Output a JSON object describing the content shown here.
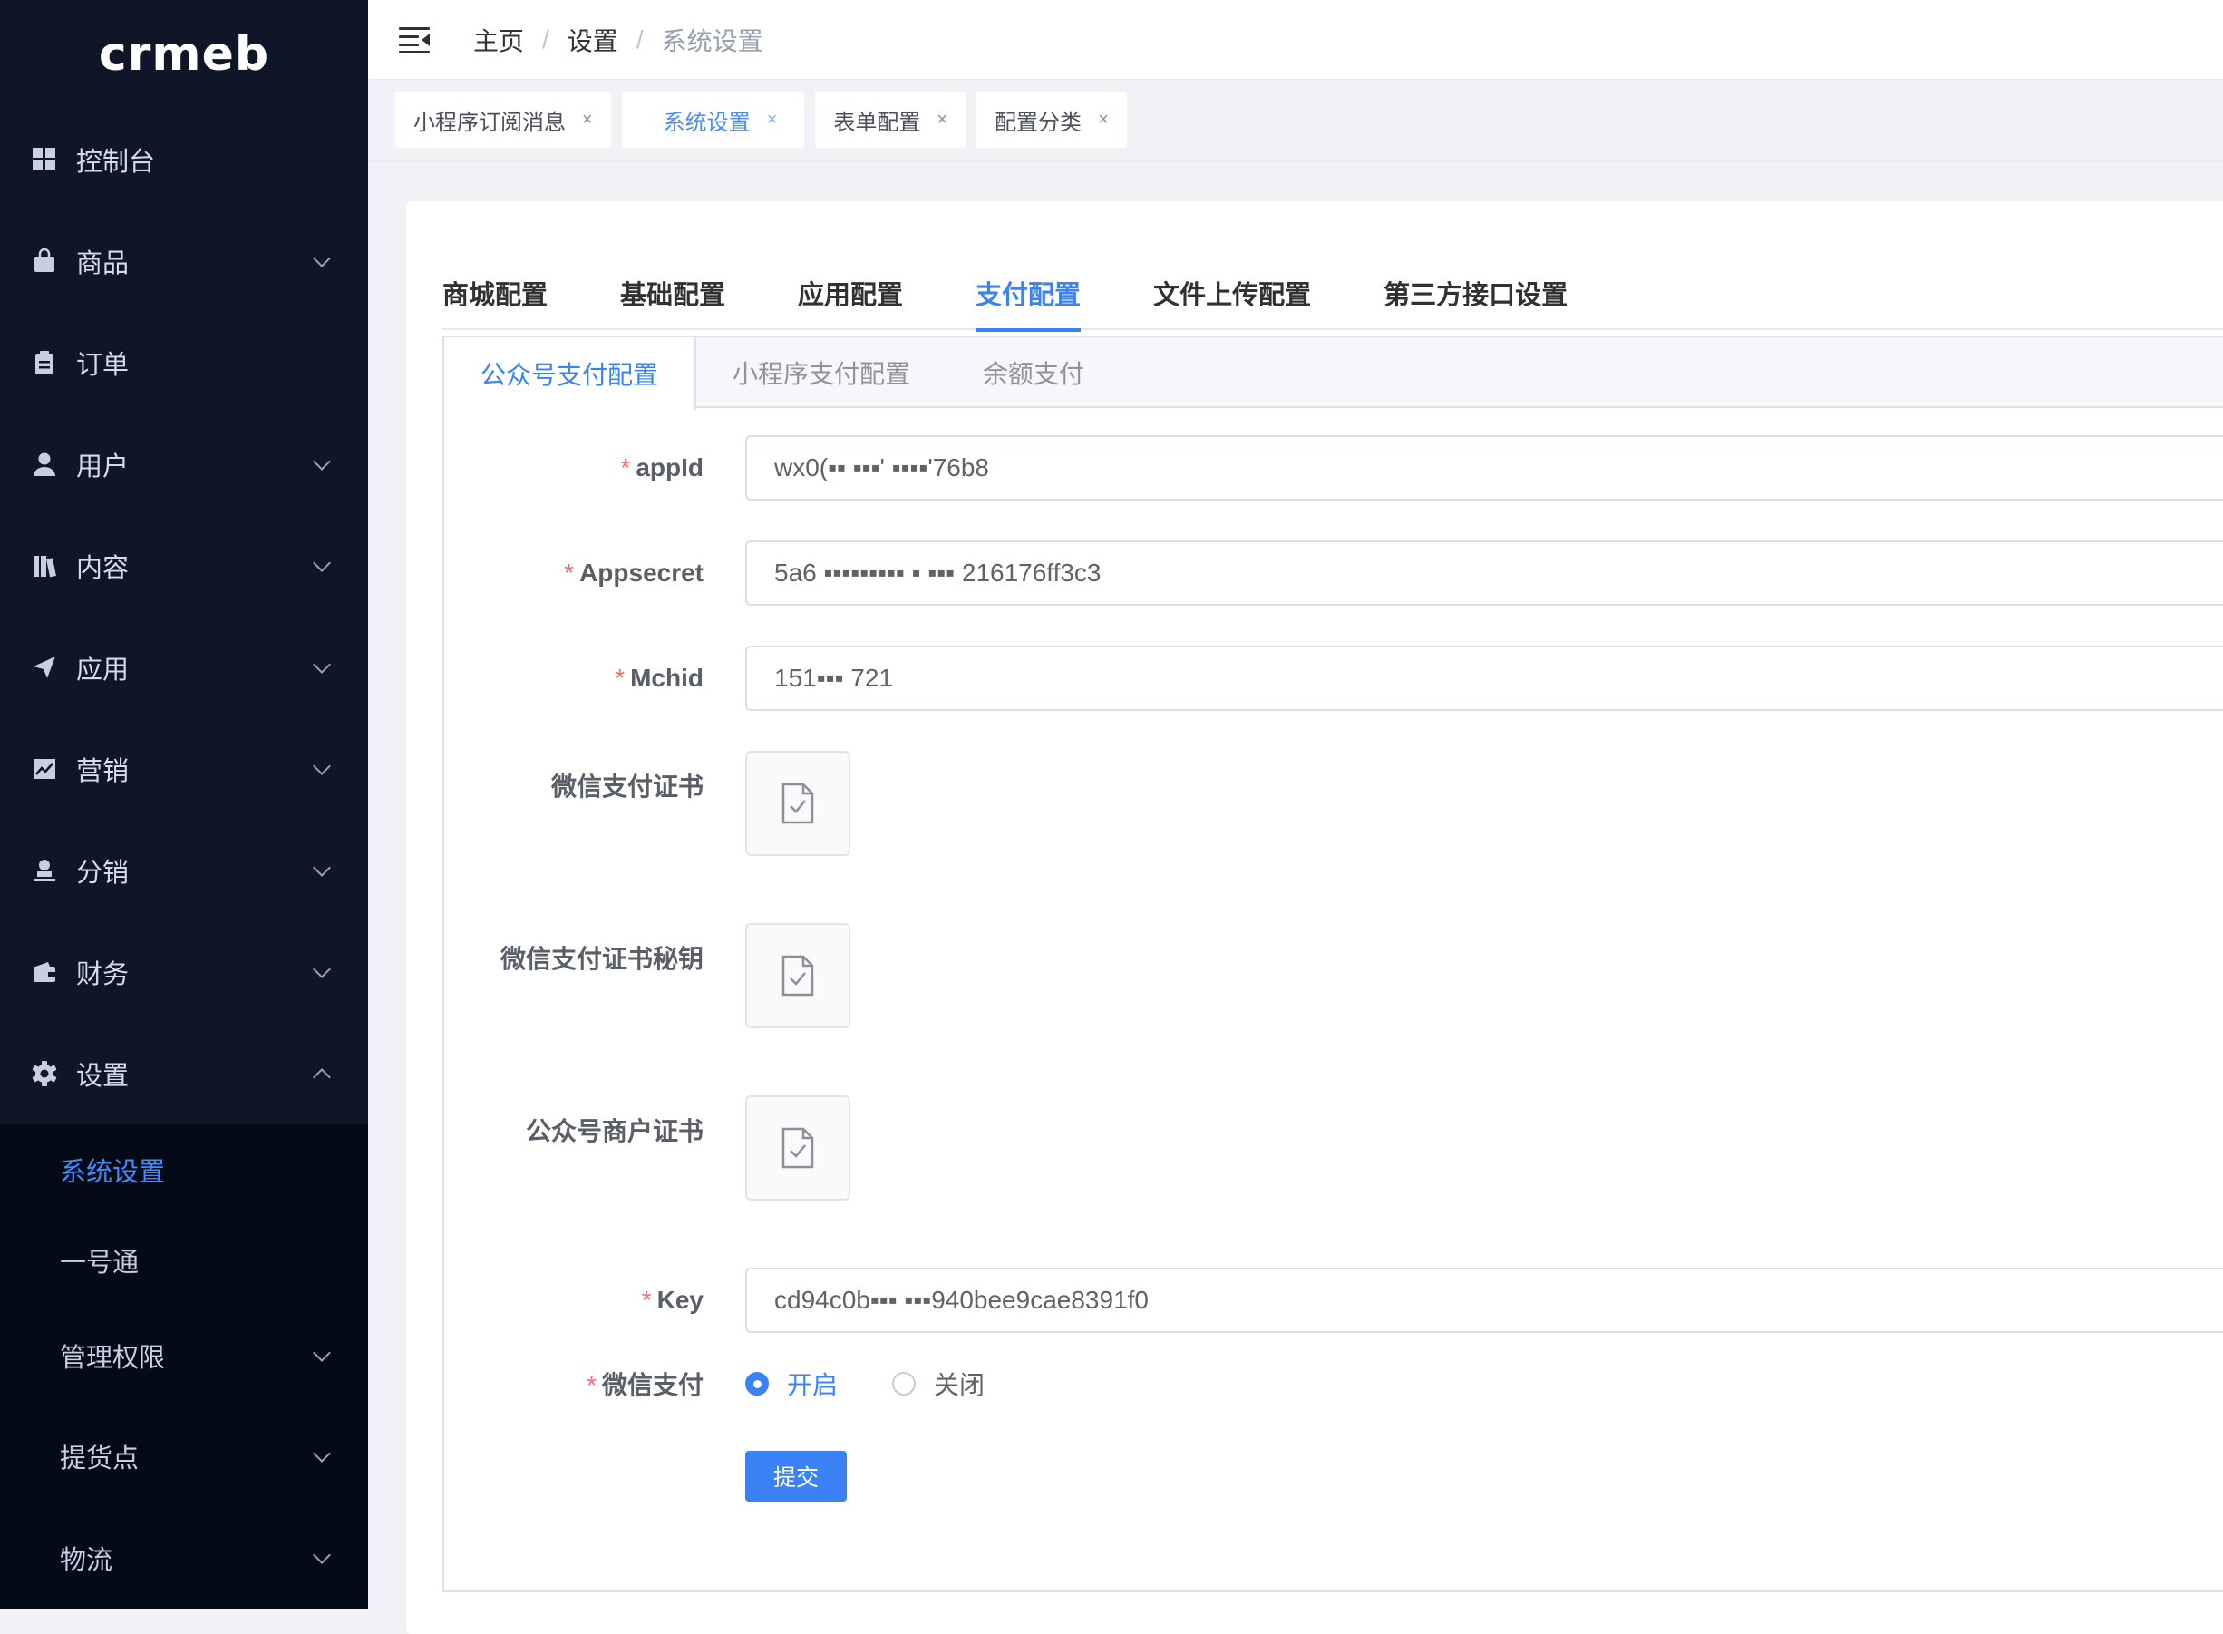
{
  "sidebar": {
    "logo": "crmeb",
    "items": [
      {
        "label": "控制台",
        "icon": "dashboard-icon",
        "has_arrow": false
      },
      {
        "label": "商品",
        "icon": "bag-icon",
        "has_arrow": true
      },
      {
        "label": "订单",
        "icon": "clipboard-icon",
        "has_arrow": false
      },
      {
        "label": "用户",
        "icon": "user-icon",
        "has_arrow": true
      },
      {
        "label": "内容",
        "icon": "library-icon",
        "has_arrow": true
      },
      {
        "label": "应用",
        "icon": "send-icon",
        "has_arrow": true
      },
      {
        "label": "营销",
        "icon": "chart-icon",
        "has_arrow": true
      },
      {
        "label": "分销",
        "icon": "stamp-icon",
        "has_arrow": true
      },
      {
        "label": "财务",
        "icon": "wallet-icon",
        "has_arrow": true
      },
      {
        "label": "设置",
        "icon": "gear-icon",
        "has_arrow": true,
        "expanded": true
      }
    ],
    "submenu": [
      {
        "label": "系统设置",
        "active": true
      },
      {
        "label": "一号通",
        "has_arrow": false
      },
      {
        "label": "管理权限",
        "has_arrow": true
      },
      {
        "label": "提货点",
        "has_arrow": true
      },
      {
        "label": "物流",
        "has_arrow": true
      }
    ]
  },
  "header": {
    "breadcrumb": [
      "主页",
      "设置",
      "系统设置"
    ],
    "separator": "/"
  },
  "tags": [
    {
      "label": "小程序订阅消息",
      "active": false
    },
    {
      "label": "系统设置",
      "active": true
    },
    {
      "label": "表单配置",
      "active": false
    },
    {
      "label": "配置分类",
      "active": false
    }
  ],
  "tag_close": "×",
  "main_tabs": [
    "商城配置",
    "基础配置",
    "应用配置",
    "支付配置",
    "文件上传配置",
    "第三方接口设置"
  ],
  "main_tab_active": "支付配置",
  "sub_tabs": [
    "公众号支付配置",
    "小程序支付配置",
    "余额支付"
  ],
  "form": {
    "appid": {
      "label": "appId",
      "value": "wx0(▪▪ ▪▪▪' ▪▪▪▪'76b8",
      "required": true
    },
    "appsecret": {
      "label": "Appsecret",
      "value": "5a6 ▪▪▪▪▪▪▪▪▪ ▪ ▪▪▪ 216176ff3c3",
      "required": true
    },
    "mchid": {
      "label": "Mchid",
      "value": "151▪▪▪ 721",
      "required": true
    },
    "cert": {
      "label": "微信支付证书"
    },
    "cert_key": {
      "label": "微信支付证书秘钥"
    },
    "merchant_cert": {
      "label": "公众号商户证书"
    },
    "key": {
      "label": "Key",
      "value": "cd94c0b▪▪▪ ▪▪▪940bee9cae8391f0",
      "required": true
    },
    "wechat_pay": {
      "label": "微信支付",
      "required": true,
      "options": [
        "开启",
        "关闭"
      ],
      "selected": "开启"
    },
    "submit": "提交"
  },
  "colors": {
    "sidebar_bg": "#0e1628",
    "accent": "#3a82f6",
    "required": "#f56c6c"
  }
}
